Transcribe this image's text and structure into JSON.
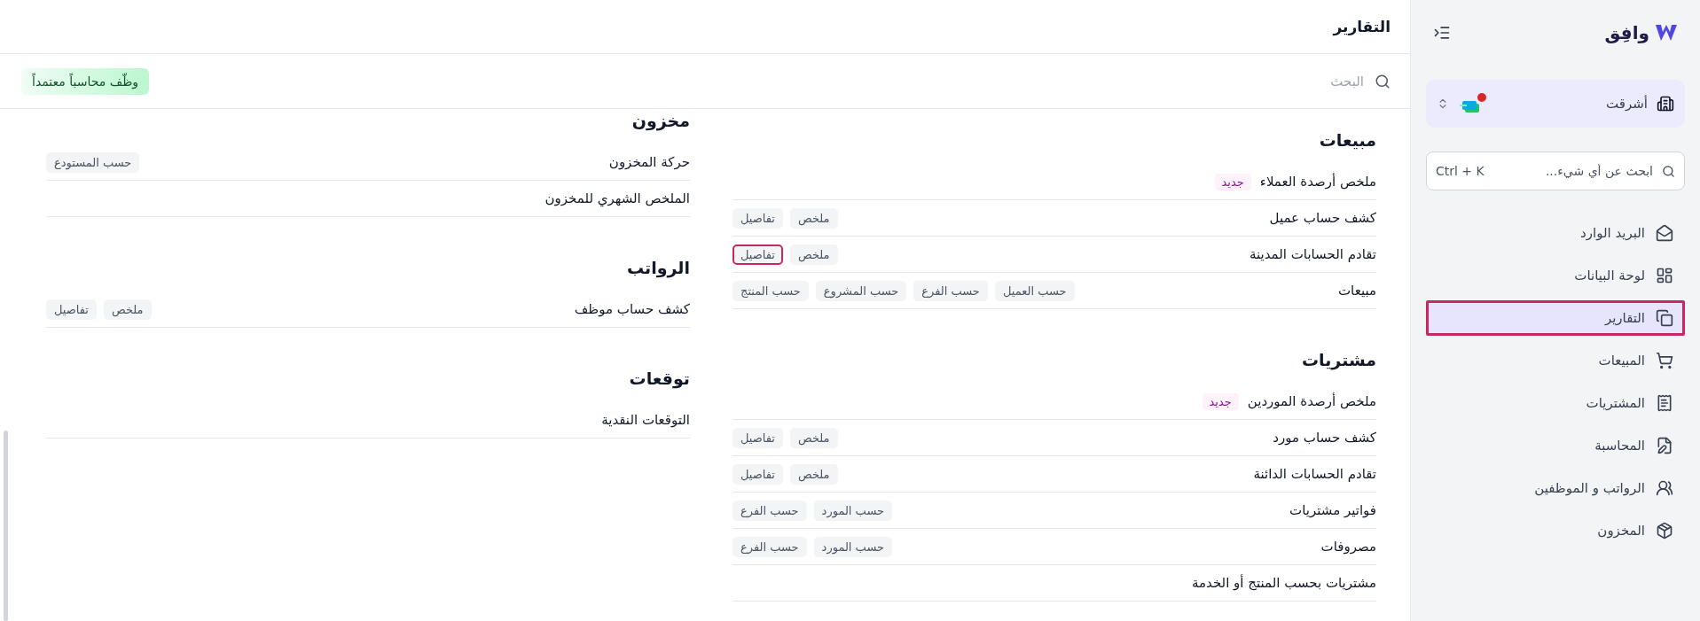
{
  "sidebar": {
    "logo": "وافِق",
    "company": {
      "name": "أشرقت",
      "alert": true
    },
    "search": {
      "placeholder": "ابحث عن أي شيء...",
      "shortcut": "Ctrl + K"
    },
    "items": [
      {
        "label": "البريد الوارد",
        "selected": false,
        "highlighted": false
      },
      {
        "label": "لوحة البيانات",
        "selected": false,
        "highlighted": false
      },
      {
        "label": "التقارير",
        "selected": true,
        "highlighted": true
      },
      {
        "label": "المبيعات",
        "selected": false,
        "highlighted": false
      },
      {
        "label": "المشتريات",
        "selected": false,
        "highlighted": false
      },
      {
        "label": "المحاسبة",
        "selected": false,
        "highlighted": false
      },
      {
        "label": "الرواتب و الموظفين",
        "selected": false,
        "highlighted": false
      },
      {
        "label": "المخزون",
        "selected": false,
        "highlighted": false
      }
    ]
  },
  "header": {
    "title": "التقارير"
  },
  "toolbar": {
    "search_placeholder": "البحث",
    "cta": "وظّف محاسباً معتمداً"
  },
  "columns": [
    [
      {
        "title": "مبيعات",
        "rows": [
          {
            "label": "ملخص أرصدة العملاء",
            "badge": "جديد"
          },
          {
            "label": "كشف حساب عميل",
            "tags": [
              {
                "label": "ملخص",
                "highlighted": false
              },
              {
                "label": "تفاصيل",
                "highlighted": false
              }
            ]
          },
          {
            "label": "تقادم الحسابات المدينة",
            "tags": [
              {
                "label": "ملخص",
                "highlighted": false
              },
              {
                "label": "تفاصيل",
                "highlighted": true
              }
            ]
          },
          {
            "label": "مبيعات",
            "tags": [
              {
                "label": "حسب العميل",
                "highlighted": false
              },
              {
                "label": "حسب الفرع",
                "highlighted": false
              },
              {
                "label": "حسب المشروع",
                "highlighted": false
              },
              {
                "label": "حسب المنتج",
                "highlighted": false
              }
            ]
          }
        ]
      },
      {
        "title": "مشتريات",
        "rows": [
          {
            "label": "ملخص أرصدة الموردين",
            "badge": "جديد"
          },
          {
            "label": "كشف حساب مورد",
            "tags": [
              {
                "label": "ملخص",
                "highlighted": false
              },
              {
                "label": "تفاصيل",
                "highlighted": false
              }
            ]
          },
          {
            "label": "تقادم الحسابات الدائنة",
            "tags": [
              {
                "label": "ملخص",
                "highlighted": false
              },
              {
                "label": "تفاصيل",
                "highlighted": false
              }
            ]
          },
          {
            "label": "فواتير مشتريات",
            "tags": [
              {
                "label": "حسب المورد",
                "highlighted": false
              },
              {
                "label": "حسب الفرع",
                "highlighted": false
              }
            ]
          },
          {
            "label": "مصروفات",
            "tags": [
              {
                "label": "حسب المورد",
                "highlighted": false
              },
              {
                "label": "حسب الفرع",
                "highlighted": false
              }
            ]
          },
          {
            "label": "مشتريات بحسب المنتج أو الخدمة"
          }
        ]
      }
    ],
    [
      {
        "title": "مخزون",
        "rows": [
          {
            "label": "حركة المخزون",
            "tags": [
              {
                "label": "حسب المستودع",
                "highlighted": false
              }
            ]
          },
          {
            "label": "الملخص الشهري للمخزون"
          }
        ]
      },
      {
        "title": "الرواتب",
        "rows": [
          {
            "label": "كشف حساب موظف",
            "tags": [
              {
                "label": "ملخص",
                "highlighted": false
              },
              {
                "label": "تفاصيل",
                "highlighted": false
              }
            ]
          }
        ]
      },
      {
        "title": "توقعات",
        "rows": [
          {
            "label": "التوقعات النقدية"
          }
        ]
      }
    ]
  ]
}
